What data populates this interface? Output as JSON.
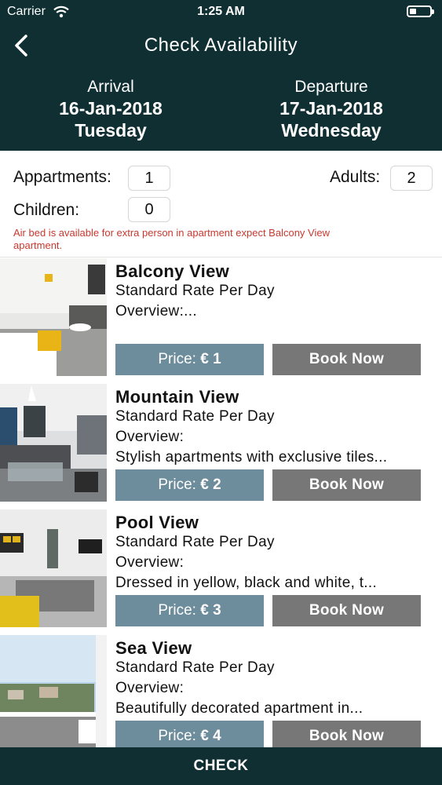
{
  "status_bar": {
    "carrier": "Carrier",
    "time": "1:25 AM"
  },
  "nav": {
    "title": "Check Availability"
  },
  "arrival": {
    "label": "Arrival",
    "date": "16-Jan-2018",
    "weekday": "Tuesday"
  },
  "departure": {
    "label": "Departure",
    "date": "17-Jan-2018",
    "weekday": "Wednesday"
  },
  "guests": {
    "apartments_label": "Appartments:",
    "apartments_value": "1",
    "adults_label": "Adults:",
    "adults_value": "2",
    "children_label": "Children:",
    "children_value": "0",
    "note": "Air bed is available for extra person in apartment expect Balcony View apartment."
  },
  "rooms": [
    {
      "name": "Balcony View",
      "rate": "Standard Rate Per Day",
      "overview": "Overview:...",
      "description": "",
      "price_label": "Price:",
      "price": "€ 1",
      "book_label": "Book Now"
    },
    {
      "name": "Mountain View",
      "rate": "Standard Rate Per Day",
      "overview": "Overview:",
      "description": "Stylish apartments with exclusive tiles...",
      "price_label": "Price:",
      "price": "€ 2",
      "book_label": "Book Now"
    },
    {
      "name": "Pool View",
      "rate": "Standard Rate Per Day",
      "overview": "Overview:",
      "description": "Dressed in yellow, black and white, t...",
      "price_label": "Price:",
      "price": "€ 3",
      "book_label": "Book Now"
    },
    {
      "name": "Sea View",
      "rate": "Standard Rate Per Day",
      "overview": "Overview:",
      "description": "Beautifully decorated apartment in...",
      "price_label": "Price:",
      "price": "€ 4",
      "book_label": "Book Now"
    }
  ],
  "footer": {
    "check_label": "CHECK"
  },
  "colors": {
    "header_bg": "#0f2f33",
    "price_button": "#6e8d9c",
    "book_button": "#777777",
    "note_text": "#c8392f"
  }
}
